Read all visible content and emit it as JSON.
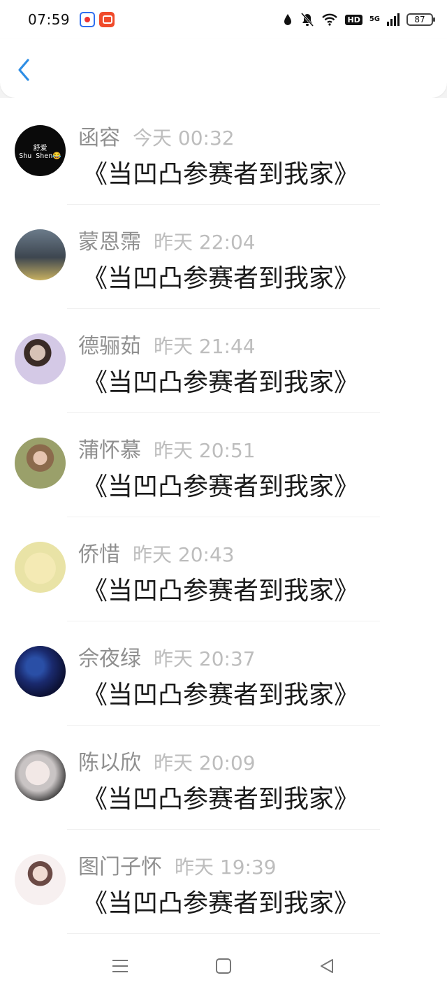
{
  "status_bar": {
    "time": "07:59",
    "hd": "HD",
    "network": "5G",
    "battery": "87"
  },
  "header": {
    "back_icon": "chevron-left-icon"
  },
  "messages": [
    {
      "name": "函容",
      "time": "今天 00:32",
      "text": "《当凹凸参赛者到我家》",
      "avatar_text": [
        "舒爱",
        "Shu Shen😂"
      ]
    },
    {
      "name": "蒙恩霈",
      "time": "昨天 22:04",
      "text": "《当凹凸参赛者到我家》"
    },
    {
      "name": "德骊茹",
      "time": "昨天 21:44",
      "text": "《当凹凸参赛者到我家》"
    },
    {
      "name": "蒲怀慕",
      "time": "昨天 20:51",
      "text": "《当凹凸参赛者到我家》"
    },
    {
      "name": "侨惜",
      "time": "昨天 20:43",
      "text": "《当凹凸参赛者到我家》"
    },
    {
      "name": "佘夜绿",
      "time": "昨天 20:37",
      "text": "《当凹凸参赛者到我家》"
    },
    {
      "name": "陈以欣",
      "time": "昨天 20:09",
      "text": "《当凹凸参赛者到我家》"
    },
    {
      "name": "图门子怀",
      "time": "昨天 19:39",
      "text": "《当凹凸参赛者到我家》"
    }
  ],
  "colors": {
    "accent": "#2e8ee5",
    "name_text": "#8f8f8f",
    "time_text": "#bdbdbd",
    "message_text": "#1a1a1a"
  }
}
